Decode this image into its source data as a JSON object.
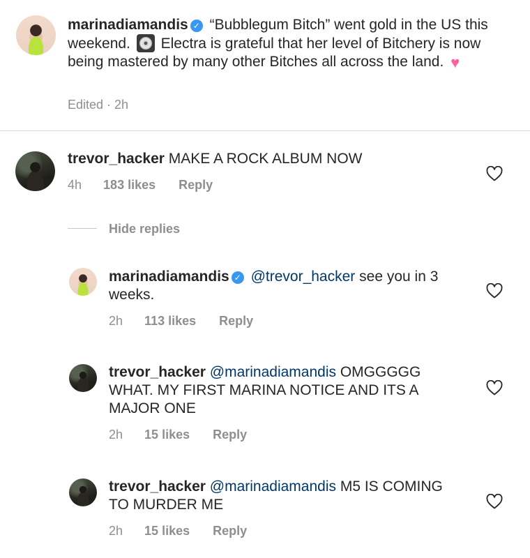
{
  "caption": {
    "username": "marinadiamandis",
    "text_before": "“Bubblegum Bitch” went gold in the US this weekend.",
    "text_after": "Electra is grateful that her level of Bitchery is now being mastered by many other Bitches all across the land.",
    "meta": "Edited · 2h"
  },
  "comment": {
    "username": "trevor_hacker",
    "text": "MAKE A ROCK ALBUM NOW",
    "time": "4h",
    "likes": "183 likes",
    "reply": "Reply"
  },
  "hide_replies": "Hide replies",
  "replies": [
    {
      "username": "marinadiamandis",
      "mention": "@trevor_hacker",
      "text": "see you in 3 weeks.",
      "time": "2h",
      "likes": "113 likes",
      "reply": "Reply"
    },
    {
      "username": "trevor_hacker",
      "mention": "@marinadiamandis",
      "text": "OMGGGGG WHAT. MY FIRST MARINA NOTICE AND ITS A MAJOR ONE",
      "time": "2h",
      "likes": "15 likes",
      "reply": "Reply"
    },
    {
      "username": "trevor_hacker",
      "mention": "@marinadiamandis",
      "text": "M5 IS COMING TO MURDER ME",
      "time": "2h",
      "likes": "15 likes",
      "reply": "Reply"
    }
  ],
  "icons": {
    "verified": "verified-badge-icon",
    "like": "heart-outline-icon",
    "disc": "cd-emoji-icon",
    "pink_heart": "pink-heart-emoji-icon"
  }
}
